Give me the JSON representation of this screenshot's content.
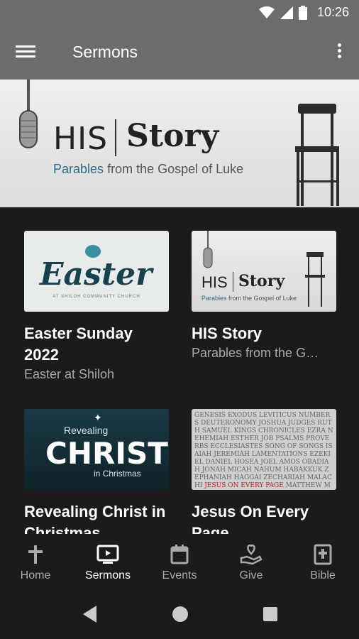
{
  "status_bar": {
    "time": "10:26"
  },
  "app_bar": {
    "title": "Sermons"
  },
  "hero": {
    "title_left": "HIS",
    "title_right": "Story",
    "subtitle_accent": "Parables",
    "subtitle_rest": "from the Gospel of Luke"
  },
  "cards": [
    {
      "title": "Easter Sunday 2022",
      "subtitle": "Easter at Shiloh",
      "thumb_word": "Easter",
      "thumb_small": "AT SHILOH COMMUNITY CHURCH"
    },
    {
      "title": "HIS Story",
      "subtitle": "Parables from the G…",
      "thumb_left": "HIS",
      "thumb_right": "Story",
      "thumb_sub_accent": "Parables",
      "thumb_sub_rest": "from the Gospel of Luke"
    },
    {
      "title": "Revealing Christ in Christmas",
      "thumb_top": "Revealing",
      "thumb_big": "CHRIST",
      "thumb_bottom": "in Christmas"
    },
    {
      "title": "Jesus On Every Page",
      "thumb_text_1": "GENESIS EXODUS LEVITICUS NUMBERS DEUTERONOMY JOSHUA JUDGES RUTH SAMUEL KINGS CHRONICLES EZRA NEHEMIAH ESTHER JOB PSALMS PROVERBS ECCLESIASTES SONG OF SONGS ISAIAH JEREMIAH LAMENTATIONS EZEKIEL DANIEL HOSEA JOEL AMOS OBADIAH JONAH MICAH NAHUM HABAKKUK ZEPHANIAH HAGGAI ZECHARIAH MALACHI",
      "thumb_text_red": "JESUS ON EVERY PAGE",
      "thumb_text_2": "MATTHEW MARK LUKE JOHN ACTS ROMANS FIRST CORINTHIANS SECOND CORINTHIANS GALATIANS EPHESIANS PHILIPPIANS COLOSSIANS FIRST THESSALONIANS SECOND THESSALONIANS FIRST"
    }
  ],
  "bottom_nav": [
    {
      "label": "Home",
      "icon": "cross-icon",
      "active": false
    },
    {
      "label": "Sermons",
      "icon": "tv-icon",
      "active": true
    },
    {
      "label": "Events",
      "icon": "calendar-icon",
      "active": false
    },
    {
      "label": "Give",
      "icon": "give-heart-icon",
      "active": false
    },
    {
      "label": "Bible",
      "icon": "bible-icon",
      "active": false
    }
  ],
  "colors": {
    "app_bar": "#6c6c6c",
    "background": "#1b1b1b",
    "accent": "#2d6b88"
  }
}
